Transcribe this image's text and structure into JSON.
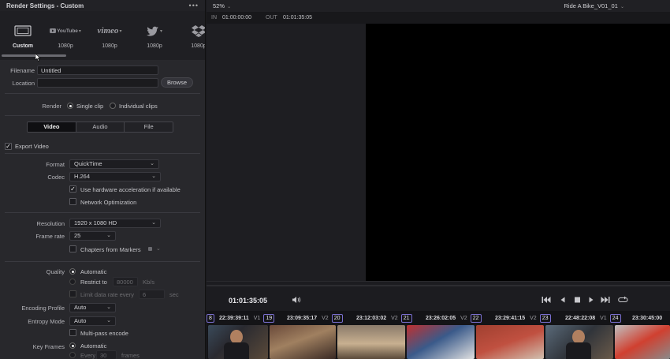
{
  "panel": {
    "title": "Render Settings - Custom",
    "menu": "•••"
  },
  "presets": [
    {
      "name": "Custom",
      "label": "Custom",
      "icon": "film-icon"
    },
    {
      "name": "youtube",
      "label": "1080p",
      "icon": "youtube-logo"
    },
    {
      "name": "vimeo",
      "label": "1080p",
      "icon": "vimeo-logo"
    },
    {
      "name": "twitter",
      "label": "1080p",
      "icon": "twitter-bird-icon"
    },
    {
      "name": "dropbox",
      "label": "1080p",
      "icon": "dropbox-icon"
    }
  ],
  "brand_text": {
    "youtube": "YouTube",
    "vimeo": "vimeo"
  },
  "file": {
    "filename_label": "Filename",
    "filename_value": "Untitled",
    "location_label": "Location",
    "location_value": "",
    "browse": "Browse"
  },
  "render": {
    "label": "Render",
    "single": "Single clip",
    "individual": "Individual clips"
  },
  "tabs": [
    "Video",
    "Audio",
    "File"
  ],
  "export_video": "Export Video",
  "format": {
    "label": "Format",
    "value": "QuickTime"
  },
  "codec": {
    "label": "Codec",
    "value": "H.264"
  },
  "hw_accel": "Use hardware acceleration if available",
  "network_opt": "Network Optimization",
  "resolution": {
    "label": "Resolution",
    "value": "1920 x 1080 HD"
  },
  "frame_rate": {
    "label": "Frame rate",
    "value": "25"
  },
  "chapters": "Chapters from Markers",
  "quality": {
    "label": "Quality",
    "automatic": "Automatic",
    "restrict": "Restrict to",
    "restrict_value": "80000",
    "restrict_unit": "Kb/s",
    "limit": "Limit data rate every",
    "limit_value": "6",
    "limit_unit": "sec"
  },
  "encoding_profile": {
    "label": "Encoding Profile",
    "value": "Auto"
  },
  "entropy_mode": {
    "label": "Entropy Mode",
    "value": "Auto"
  },
  "multipass": "Multi-pass encode",
  "key_frames": {
    "label": "Key Frames",
    "automatic": "Automatic",
    "every": "Every",
    "every_value": "30",
    "every_unit": "frames"
  },
  "viewer": {
    "zoom": "52%",
    "title": "Ride A Bike_V01_01",
    "in_label": "IN",
    "in_value": "01:00:00:00",
    "out_label": "OUT",
    "out_value": "01:01:35:05"
  },
  "transport": {
    "timecode": "01:01:35:05"
  },
  "clips": [
    {
      "tc": "22:39:39:11",
      "track": "V1",
      "num": "19"
    },
    {
      "tc": "23:09:35:17",
      "track": "V2",
      "num": "20"
    },
    {
      "tc": "23:12:03:02",
      "track": "V2",
      "num": "21"
    },
    {
      "tc": "23:26:02:05",
      "track": "V2",
      "num": "22"
    },
    {
      "tc": "23:29:41:15",
      "track": "V2",
      "num": "23"
    },
    {
      "tc": "22:48:22:08",
      "track": "V1",
      "num": "24"
    },
    {
      "tc": "23:30:45:00",
      "track": "",
      "num": ""
    }
  ],
  "clip_partial_num": "8",
  "colors": {
    "accent": "#7a6fd0",
    "panel_bg": "#28282c",
    "viewer_bg": "#000000"
  }
}
